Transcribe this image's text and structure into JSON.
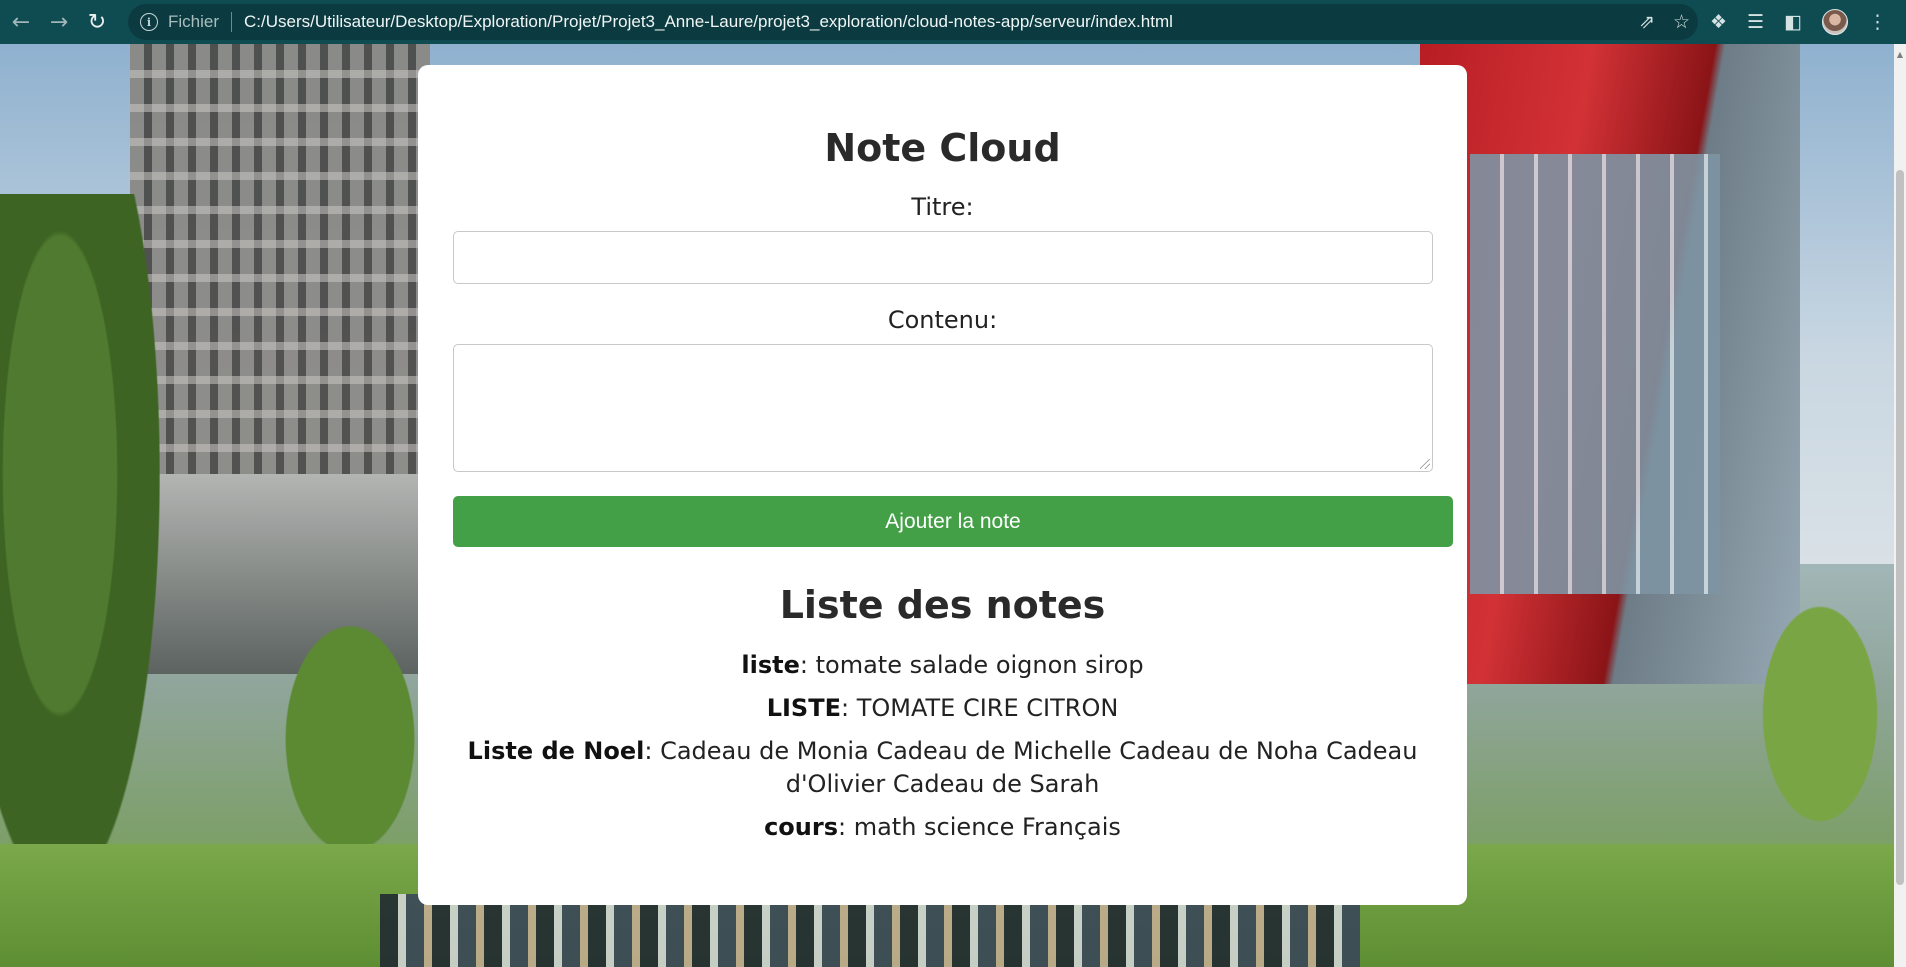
{
  "browser": {
    "scheme_label": "Fichier",
    "url": "C:/Users/Utilisateur/Desktop/Exploration/Projet/Projet3_Anne-Laure/projet3_exploration/cloud-notes-app/serveur/index.html"
  },
  "app": {
    "title": "Note Cloud",
    "form": {
      "title_label": "Titre:",
      "title_value": "",
      "content_label": "Contenu:",
      "content_value": "",
      "submit_label": "Ajouter la note"
    },
    "list_title": "Liste des notes",
    "notes": [
      {
        "title": "liste",
        "content": "tomate salade oignon sirop"
      },
      {
        "title": "LISTE",
        "content": "TOMATE CIRE CITRON"
      },
      {
        "title": "Liste de Noel",
        "content": "Cadeau de Monia Cadeau de Michelle Cadeau de Noha Cadeau d'Olivier Cadeau de Sarah"
      },
      {
        "title": "cours",
        "content": "math science Français"
      }
    ]
  },
  "colors": {
    "toolbar": "#0f4c52",
    "button": "#43a047"
  }
}
